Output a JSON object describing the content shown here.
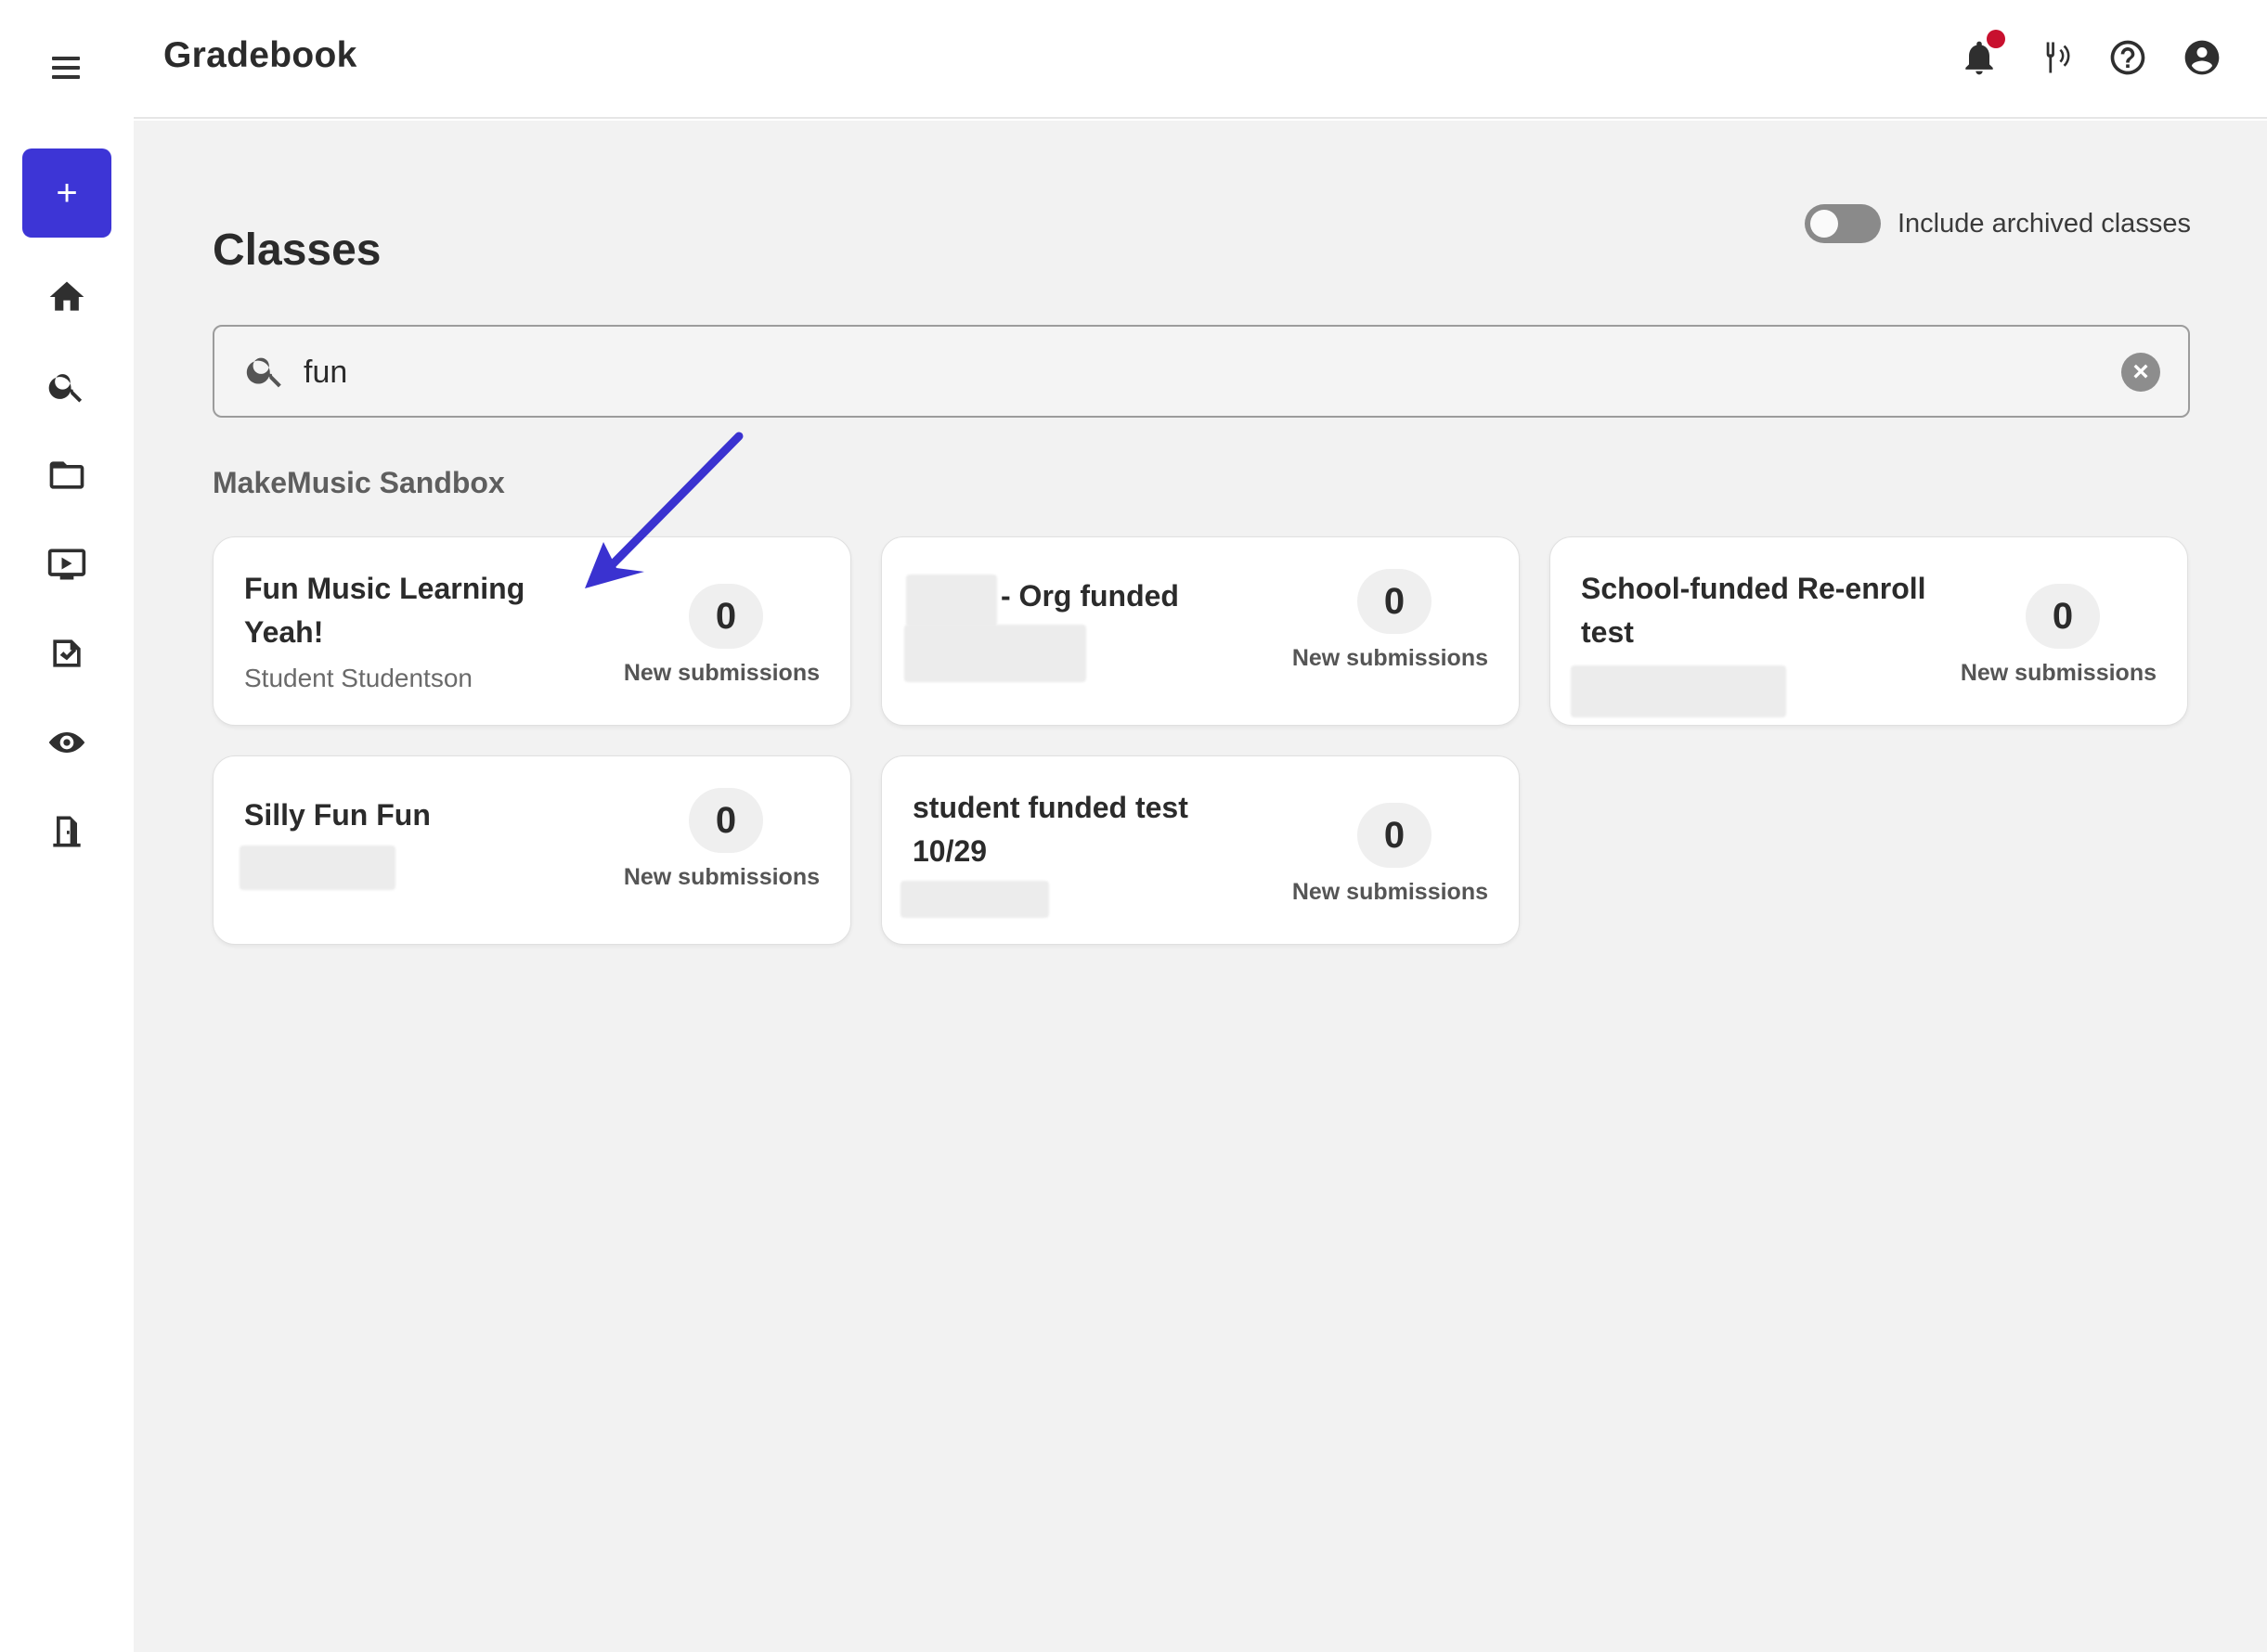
{
  "app": {
    "title": "Gradebook"
  },
  "sidebar": {
    "add_label": "+",
    "items": [
      {
        "name": "home-icon"
      },
      {
        "name": "search-icon"
      },
      {
        "name": "folder-icon"
      },
      {
        "name": "video-icon"
      },
      {
        "name": "assignment-icon"
      },
      {
        "name": "listen-icon"
      },
      {
        "name": "exit-icon"
      }
    ]
  },
  "topbar": {
    "icons": [
      "bell-icon",
      "tuner-icon",
      "help-icon",
      "account-icon"
    ],
    "accent": "#c8102e"
  },
  "page": {
    "title": "Classes",
    "archived_toggle_label": "Include archived classes",
    "archived_toggle_on": false,
    "search_value": "fun",
    "group_title": "MakeMusic Sandbox"
  },
  "classes": [
    {
      "title": "Fun Music Learning Yeah!",
      "subtitle": "Student Studentson",
      "count": "0",
      "count_label": "New submissions"
    },
    {
      "title": "- Org funded",
      "subtitle": "",
      "count": "0",
      "count_label": "New submissions"
    },
    {
      "title": "School-funded Re-enroll test",
      "subtitle": "",
      "count": "0",
      "count_label": "New submissions"
    },
    {
      "title": "Silly Fun Fun",
      "subtitle": "",
      "count": "0",
      "count_label": "New submissions"
    },
    {
      "title": "student funded test 10/29",
      "subtitle": "",
      "count": "0",
      "count_label": "New submissions"
    }
  ],
  "colors": {
    "primary": "#3d35d6",
    "annotation_arrow": "#3a32d0"
  }
}
